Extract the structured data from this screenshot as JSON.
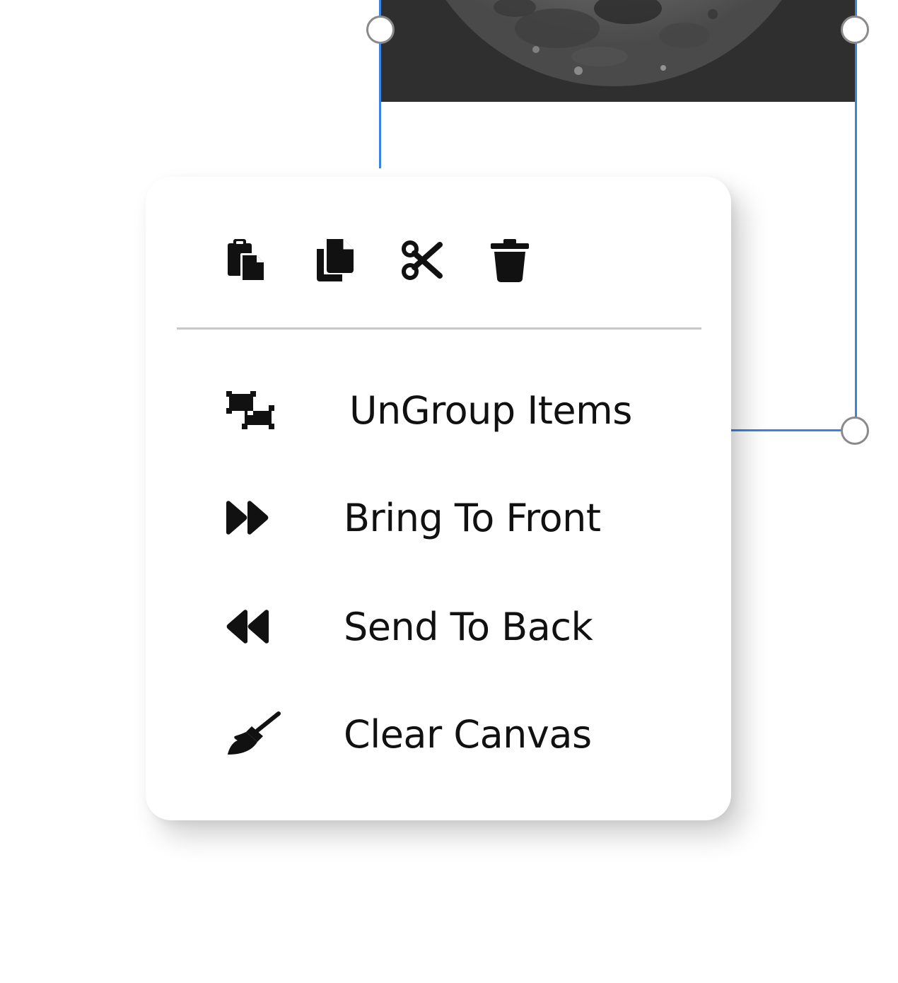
{
  "canvas": {
    "image_object": {
      "icon": "moon-photo",
      "background_color": "#2f2f2f"
    },
    "selection_color": "#3b82e6"
  },
  "context_menu": {
    "toolbar": [
      {
        "id": "paste",
        "icon": "paste-icon"
      },
      {
        "id": "copy",
        "icon": "copy-icon"
      },
      {
        "id": "cut",
        "icon": "scissors-icon"
      },
      {
        "id": "delete",
        "icon": "trash-icon"
      }
    ],
    "items": [
      {
        "id": "ungroup",
        "icon": "ungroup-icon",
        "label": "UnGroup Items"
      },
      {
        "id": "bring-to-front",
        "icon": "fast-forward-icon",
        "label": "Bring To Front"
      },
      {
        "id": "send-to-back",
        "icon": "fast-backward-icon",
        "label": "Send To Back"
      },
      {
        "id": "clear-canvas",
        "icon": "broom-icon",
        "label": "Clear Canvas"
      }
    ]
  }
}
